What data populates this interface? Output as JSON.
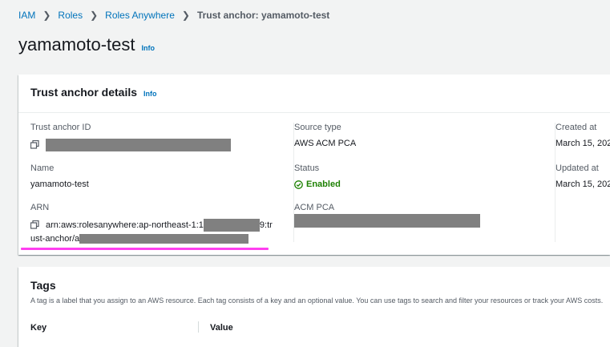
{
  "breadcrumb": {
    "items": [
      "IAM",
      "Roles",
      "Roles Anywhere"
    ],
    "current": "Trust anchor: yamamoto-test"
  },
  "page": {
    "title": "yamamoto-test",
    "info": "Info"
  },
  "details": {
    "title": "Trust anchor details",
    "info": "Info",
    "trust_anchor_id_label": "Trust anchor ID",
    "name_label": "Name",
    "name_value": "yamamoto-test",
    "arn_label": "ARN",
    "arn_part1": "arn:aws:rolesanywhere:ap-northeast-1:1",
    "arn_part2": "9:tr",
    "arn_line2": "ust-anchor/a",
    "source_type_label": "Source type",
    "source_type_value": "AWS ACM PCA",
    "status_label": "Status",
    "status_value": "Enabled",
    "acm_pca_label": "ACM PCA",
    "created_label": "Created at",
    "created_value": "March 15, 202",
    "updated_label": "Updated at",
    "updated_value": "March 15, 202"
  },
  "tags": {
    "title": "Tags",
    "description": "A tag is a label that you assign to an AWS resource. Each tag consists of a key and an optional value. You can use tags to search and filter your resources or track your AWS costs.",
    "columns": [
      "Key",
      "Value"
    ]
  },
  "colors": {
    "link": "#0073bb",
    "success": "#1d8102",
    "highlight": "#ff3ef0",
    "redaction": "#808080"
  }
}
